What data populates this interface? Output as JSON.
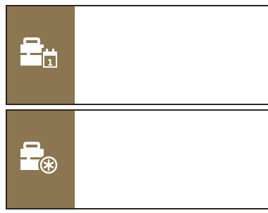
{
  "colors": {
    "strip": "#8c7551",
    "border": "#2b2521",
    "content": "#ffffff",
    "icon": "#ffffff"
  },
  "tiles": [
    {
      "icon": "briefcase-calendar-icon"
    },
    {
      "icon": "briefcase-settings-icon"
    }
  ]
}
